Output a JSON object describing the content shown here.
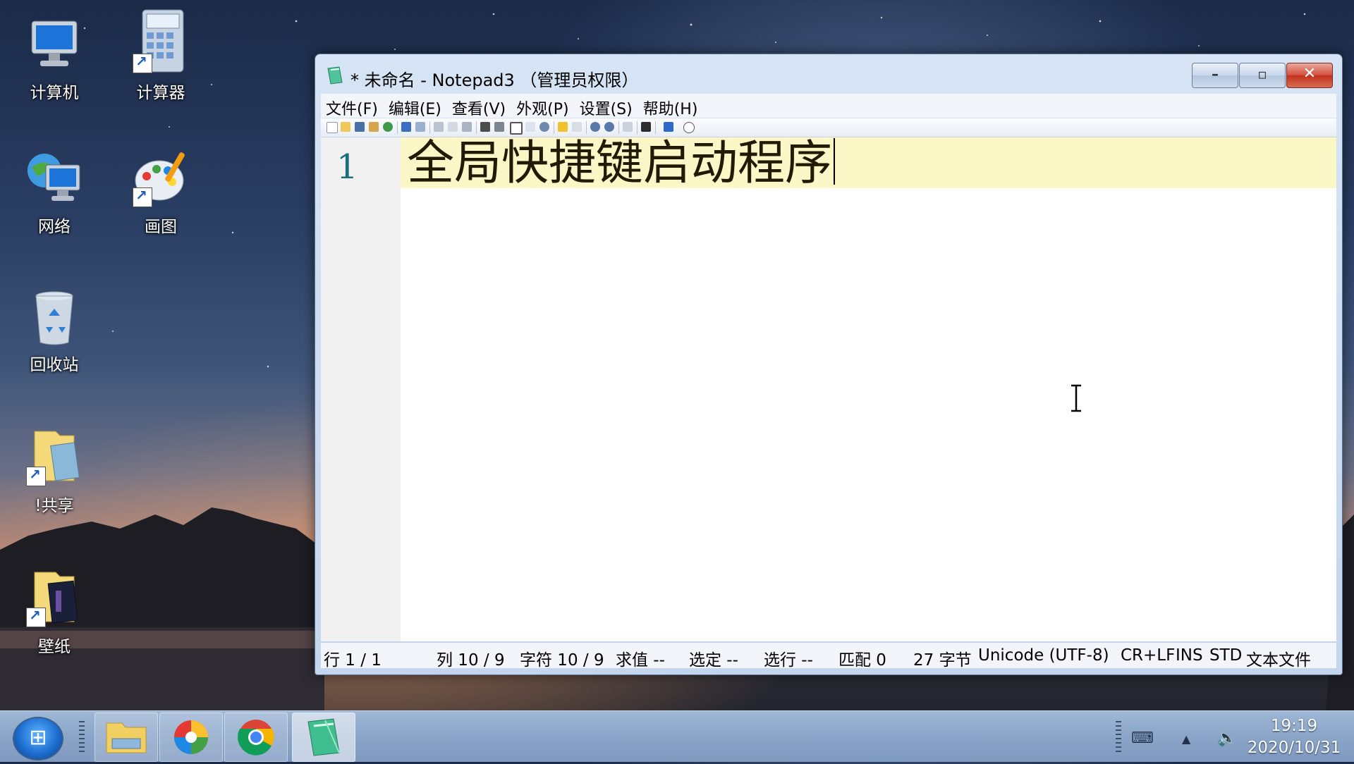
{
  "desktop": {
    "icons": [
      {
        "label": "计算机"
      },
      {
        "label": "计算器"
      },
      {
        "label": "网络"
      },
      {
        "label": "画图"
      },
      {
        "label": "回收站"
      },
      {
        "label": "!共享"
      },
      {
        "label": "壁纸"
      }
    ]
  },
  "window": {
    "title": "* 未命名 - Notepad3 （管理员权限）",
    "menu": [
      "文件(F)",
      "编辑(E)",
      "查看(V)",
      "外观(P)",
      "设置(S)",
      "帮助(H)"
    ],
    "editor": {
      "line_number": "1",
      "content": "全局快捷键启动程序"
    },
    "status": {
      "line": "行  1 / 1",
      "col": "列  10 / 9",
      "chars": "字符  10 / 9",
      "eval": "求值  --",
      "selection": "选定  --",
      "sel_lines": "选行  --",
      "match": "匹配  0",
      "bytes": "27 字节",
      "encoding": "Unicode (UTF-8)",
      "eol": "CR+LF",
      "ins": "INS",
      "std": "STD",
      "filetype": "文本文件"
    }
  },
  "taskbar": {
    "clock_time": "19:19",
    "clock_date": "2020/10/31",
    "apps": [
      "file-explorer",
      "multicolor-app",
      "chrome",
      "notepad3"
    ]
  },
  "colors": {
    "current_line": "#fcf7c6",
    "line_number": "#1a6e7a",
    "close_button": "#c2321e"
  }
}
